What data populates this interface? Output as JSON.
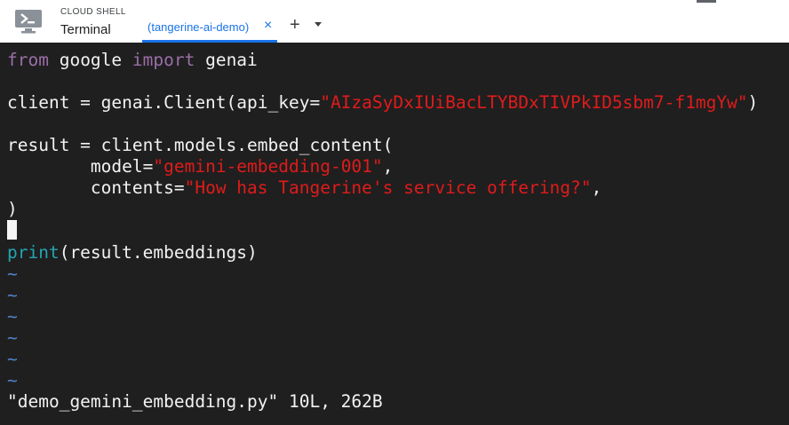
{
  "header": {
    "app_small": "CLOUD SHELL",
    "app_title": "Terminal",
    "tab_label": "(tangerine-ai-demo)",
    "close_glyph": "×",
    "add_glyph": "+"
  },
  "colors": {
    "accent": "#1a73e8",
    "terminal_bg": "#1f1f1f",
    "keyword": "#9b6ea8",
    "string": "#e01b1b",
    "builtin": "#22a5b0",
    "tilde": "#4f83c7"
  },
  "icons": {
    "logo": "cloud-shell-terminal-icon",
    "close": "close-icon",
    "add": "add-icon",
    "menu": "chevron-down-icon"
  },
  "code": {
    "l1_from": "from",
    "l1_mid": " google ",
    "l1_import": "import",
    "l1_end": " genai",
    "l3_pre": "client = genai.Client(api_key=",
    "l3_key": "\"AIzaSyDxIUiBacLTYBDxTIVPkID5sbm7-f1mgYw\"",
    "l3_post": ")",
    "l5": "result = client.models.embed_content(",
    "l6_pre": "        model=",
    "l6_str": "\"gemini-embedding-001\"",
    "l6_post": ",",
    "l7_pre": "        contents=",
    "l7_str": "\"How has Tangerine's service offering?\"",
    "l7_post": ",",
    "l8": ")",
    "l10_print": "print",
    "l10_rest": "(result.embeddings)",
    "tilde": "~"
  },
  "status": {
    "message": "\"demo_gemini_embedding.py\" 10L, 262B"
  }
}
